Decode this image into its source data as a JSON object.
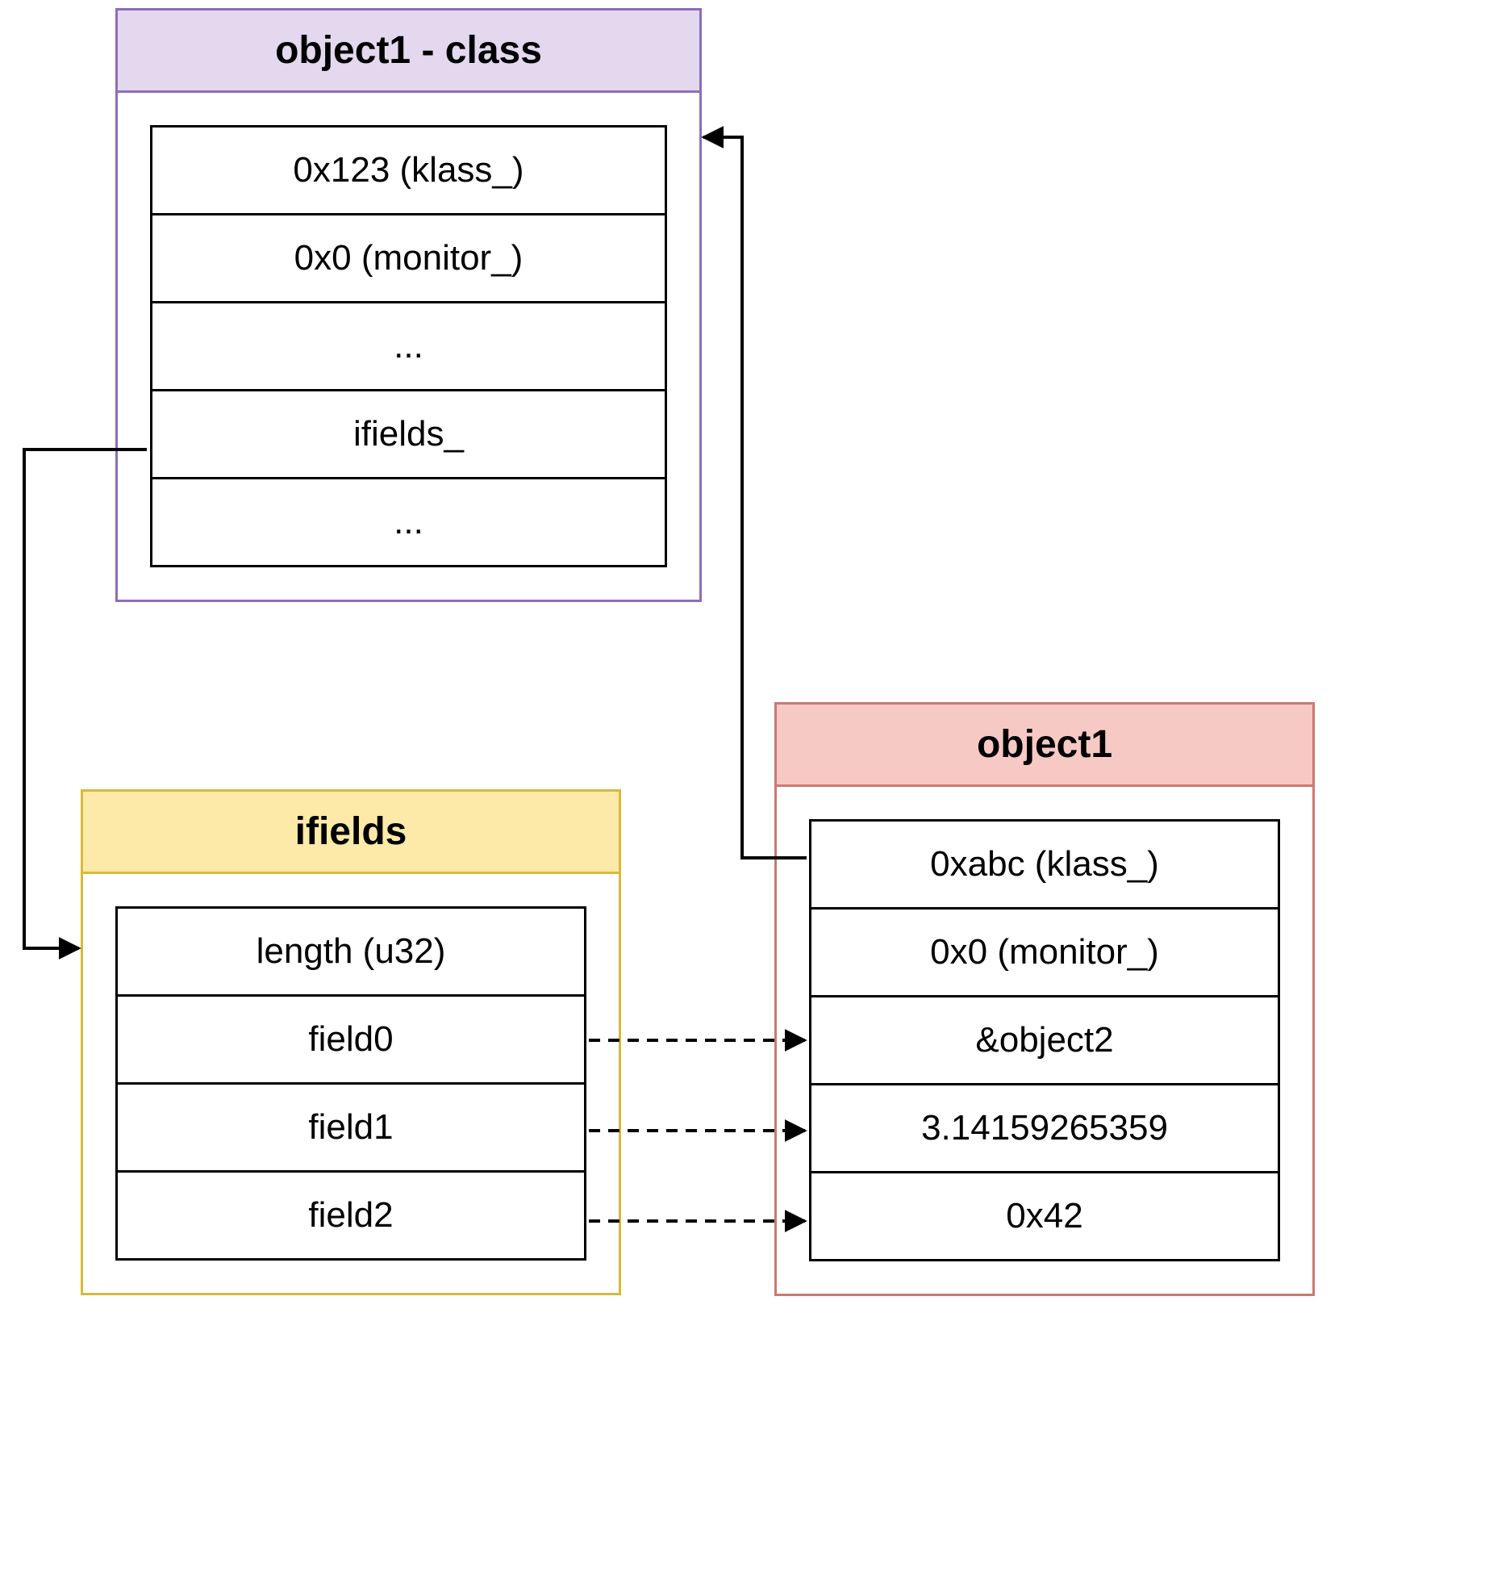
{
  "colors": {
    "purple_border": "#8e6db8",
    "purple_fill": "#e3d8ee",
    "yellow_border": "#d8b93a",
    "yellow_fill": "#fde9a8",
    "red_border": "#cc7871",
    "red_fill": "#f6c9c5"
  },
  "boxes": {
    "class": {
      "title": "object1 - class",
      "rows": [
        "0x123 (klass_)",
        "0x0 (monitor_)",
        "...",
        "ifields_",
        "..."
      ]
    },
    "ifields": {
      "title": "ifields",
      "rows": [
        "length (u32)",
        "field0",
        "field1",
        "field2"
      ]
    },
    "object1": {
      "title": "object1",
      "rows": [
        "0xabc (klass_)",
        "0x0 (monitor_)",
        "&object2",
        "3.14159265359",
        "0x42"
      ]
    }
  }
}
